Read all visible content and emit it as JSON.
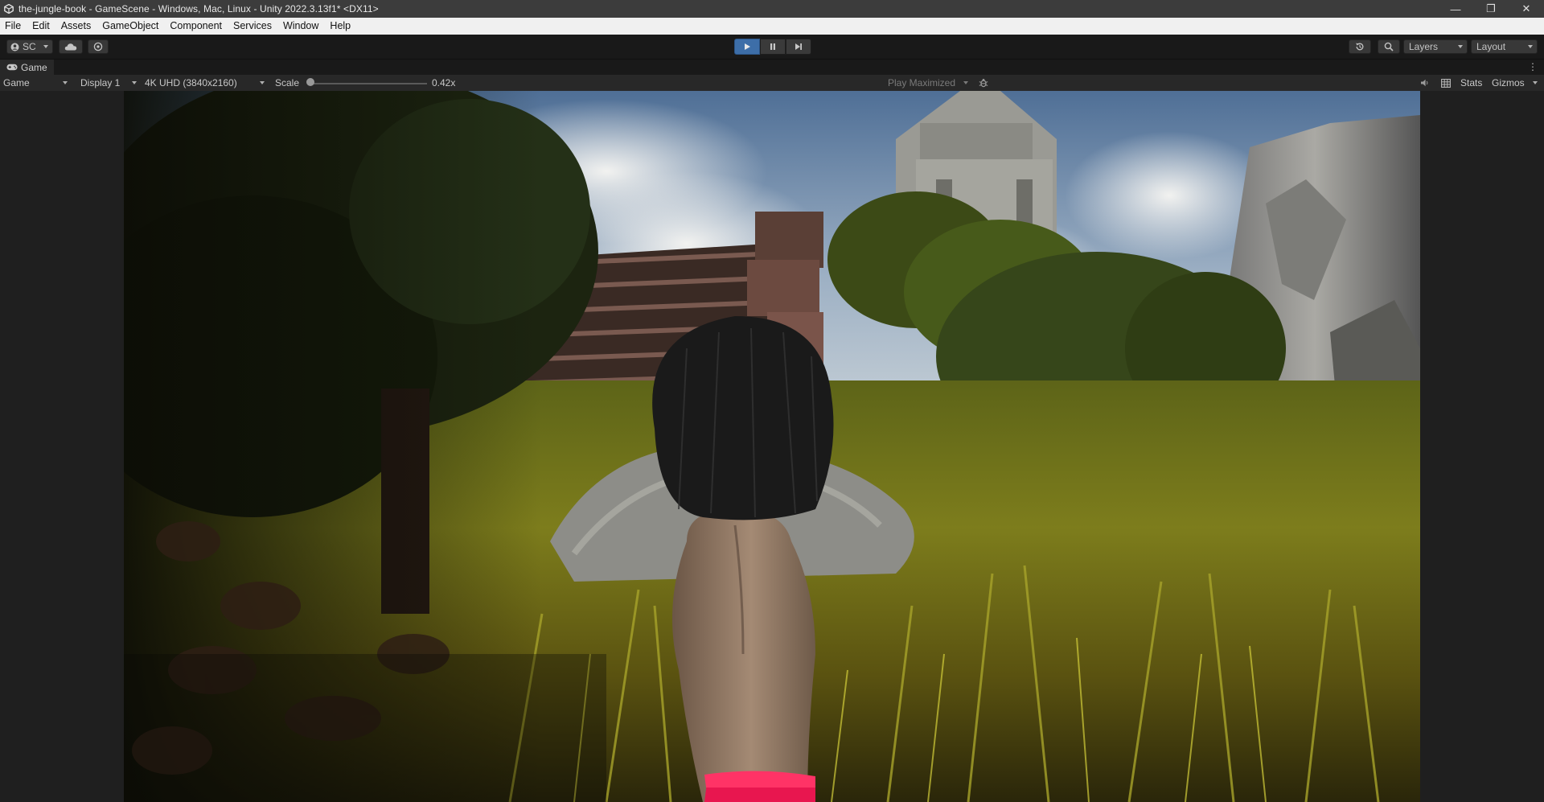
{
  "window": {
    "title": "the-jungle-book - GameScene - Windows, Mac, Linux - Unity 2022.3.13f1* <DX11>",
    "controls": {
      "minimize": "—",
      "maximize": "❐",
      "close": "✕"
    }
  },
  "menubar": {
    "items": [
      "File",
      "Edit",
      "Assets",
      "GameObject",
      "Component",
      "Services",
      "Window",
      "Help"
    ]
  },
  "toolbar": {
    "account_label": "SC",
    "layers_label": "Layers",
    "layout_label": "Layout",
    "play_state": "playing"
  },
  "tab": {
    "label": "Game"
  },
  "game_toolbar": {
    "view_mode": "Game",
    "display": "Display 1",
    "resolution": "4K UHD (3840x2160)",
    "scale_label": "Scale",
    "scale_value": "0.42x",
    "scale_fraction": 0,
    "play_mode": "Play Maximized",
    "stats_label": "Stats",
    "gizmos_label": "Gizmos"
  },
  "colors": {
    "play_active": "#3d6ea8",
    "title_bar": "#3c3c3c",
    "menu_bar": "#f0f0f0",
    "panel": "#282828"
  }
}
